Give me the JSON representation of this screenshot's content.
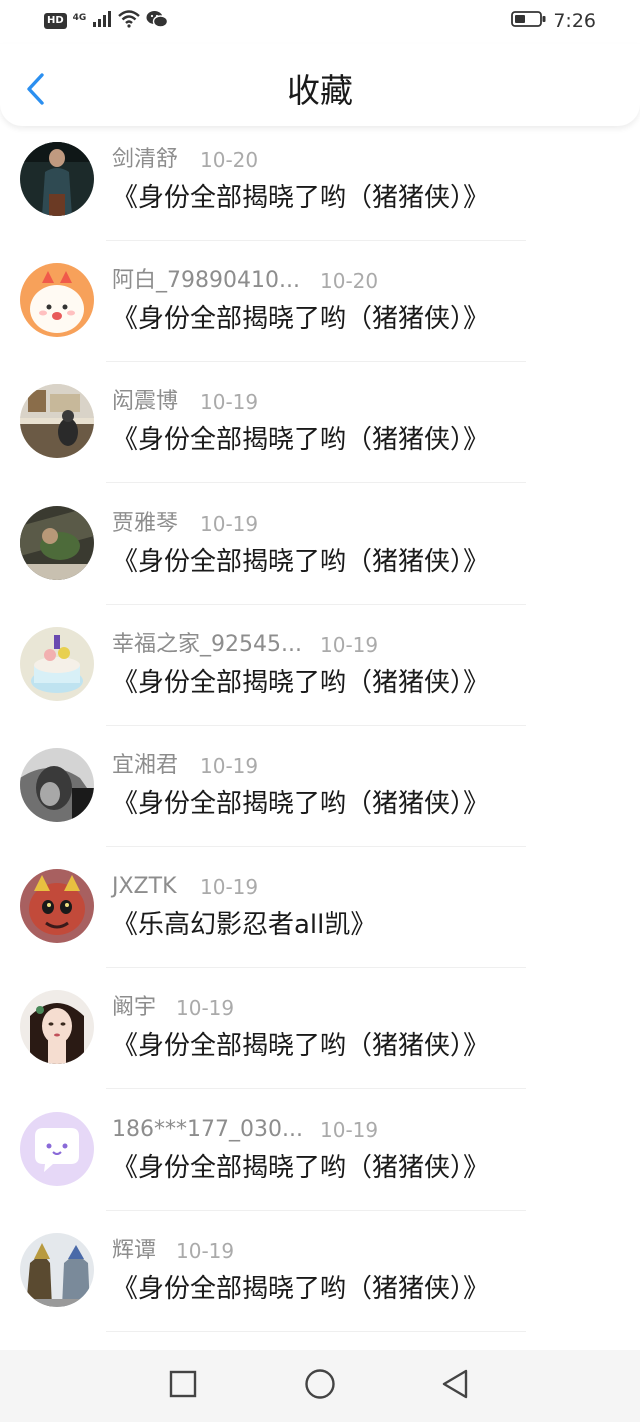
{
  "status_bar": {
    "hd": "HD",
    "network": "4G",
    "time": "7:26"
  },
  "header": {
    "title": "收藏",
    "back_icon": "chevron-left-icon"
  },
  "colors": {
    "accent": "#2b8ff0",
    "username": "#8d8d8d",
    "date": "#aaaaaa",
    "title": "#1a1a1a"
  },
  "items": [
    {
      "user": "剑清舒",
      "date": "10-20",
      "title": "《身份全部揭晓了哟（猪猪侠）》"
    },
    {
      "user": "阿白_79890410...",
      "date": "10-20",
      "title": "《身份全部揭晓了哟（猪猪侠）》"
    },
    {
      "user": "闳震博",
      "date": "10-19",
      "title": "《身份全部揭晓了哟（猪猪侠）》"
    },
    {
      "user": "贾雅琴",
      "date": "10-19",
      "title": "《身份全部揭晓了哟（猪猪侠）》"
    },
    {
      "user": "幸福之家_92545...",
      "date": "10-19",
      "title": "《身份全部揭晓了哟（猪猪侠）》"
    },
    {
      "user": "宜湘君",
      "date": "10-19",
      "title": "《身份全部揭晓了哟（猪猪侠）》"
    },
    {
      "user": "JXZTK",
      "date": "10-19",
      "title": "《乐高幻影忍者all凯》"
    },
    {
      "user": "阚宇",
      "date": "10-19",
      "title": "《身份全部揭晓了哟（猪猪侠）》"
    },
    {
      "user": "186***177_030...",
      "date": "10-19",
      "title": "《身份全部揭晓了哟（猪猪侠）》"
    },
    {
      "user": "辉谭",
      "date": "10-19",
      "title": "《身份全部揭晓了哟（猪猪侠）》"
    }
  ],
  "nav": {
    "recent_icon": "square-icon",
    "home_icon": "circle-icon",
    "back_icon": "triangle-back-icon"
  }
}
